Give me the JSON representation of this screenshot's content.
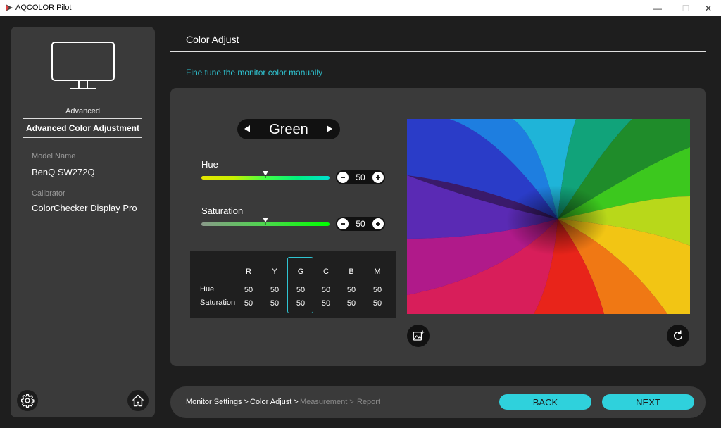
{
  "window": {
    "title": "AQCOLOR Pilot",
    "minimize": "—",
    "maximize": "☐",
    "close": "✕"
  },
  "sidebar": {
    "mode_label": "Advanced",
    "mode_title": "Advanced Color Adjustment",
    "model_label": "Model Name",
    "model_value": "BenQ SW272Q",
    "calibrator_label": "Calibrator",
    "calibrator_value": "ColorChecker Display Pro",
    "settings_icon": "gear-icon",
    "home_icon": "home-icon"
  },
  "main": {
    "title": "Color Adjust",
    "subtitle": "Fine tune the monitor color manually",
    "selected_color": "Green",
    "hue": {
      "label": "Hue",
      "value": "50",
      "level": 0.5
    },
    "saturation": {
      "label": "Saturation",
      "value": "50",
      "level": 0.5
    },
    "table": {
      "columns": [
        "R",
        "Y",
        "G",
        "C",
        "B",
        "M"
      ],
      "selected_column": "G",
      "rows": [
        {
          "label": "Hue",
          "values": [
            "50",
            "50",
            "50",
            "50",
            "50",
            "50"
          ]
        },
        {
          "label": "Saturation",
          "values": [
            "50",
            "50",
            "50",
            "50",
            "50",
            "50"
          ]
        }
      ]
    },
    "preview_icons": {
      "add_image": "add-image-icon",
      "reset": "reset-icon"
    }
  },
  "footer": {
    "breadcrumbs": [
      {
        "label": "Monitor Settings >",
        "active": true
      },
      {
        "label": "Color Adjust >",
        "active": true
      },
      {
        "label": "Measurement >",
        "active": false
      },
      {
        "label": "Report",
        "active": false
      }
    ],
    "back_label": "BACK",
    "next_label": "NEXT"
  },
  "colors": {
    "accent": "#2fc5d3",
    "button": "#2fd1dc",
    "panel": "#3a3a3a",
    "background": "#1e1e1e"
  }
}
